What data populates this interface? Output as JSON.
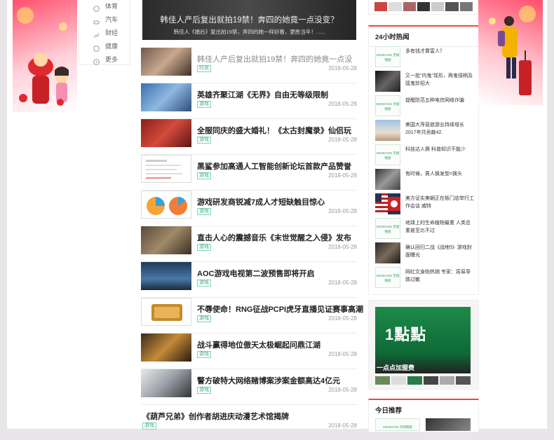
{
  "left_nav": [
    {
      "label": "体育",
      "icon": "sports-icon"
    },
    {
      "label": "汽车",
      "icon": "car-icon"
    },
    {
      "label": "财经",
      "icon": "finance-icon"
    },
    {
      "label": "健康",
      "icon": "health-icon"
    },
    {
      "label": "更多",
      "icon": "more-icon"
    }
  ],
  "hero": {
    "title": "韩佳人产后复出就拍19禁！奔四的她竟一点没变？",
    "subtitle": "韩佳人《婚后》复出拍19禁，奔四的她一样好看，更胜当年！......"
  },
  "news": [
    {
      "title": "韩佳人产后复出就拍19禁！奔四的她竟一点没",
      "tag": "时尚",
      "date": "2018-05-28"
    },
    {
      "title": "英雄齐聚江湖《无界》自由无等级限制",
      "tag": "游戏",
      "date": "2018-05-28"
    },
    {
      "title": "全服同庆的盛大婚礼！《太古封魔录》仙侣玩",
      "tag": "游戏",
      "date": "2018-05-28"
    },
    {
      "title": "黑鲨参加高通人工智能创新论坛首款产品赞誉",
      "tag": "游戏",
      "date": "2018-05-28"
    },
    {
      "title": "游戏研发商锐减7成人才短缺触目惊心",
      "tag": "游戏",
      "date": "2018-05-28"
    },
    {
      "title": "直击人心的震撼音乐《末世觉醒之入侵》发布",
      "tag": "游戏",
      "date": "2018-05-28"
    },
    {
      "title": "AOC游戏电视第二波预售即将开启",
      "tag": "游戏",
      "date": "2018-05-28"
    },
    {
      "title": "不辱使命！RNG征战PCPI虎牙直播见证赛事高潮",
      "tag": "游戏",
      "date": "2018-05-28"
    },
    {
      "title": "战斗赢得地位傲天太极崛起问鼎江湖",
      "tag": "游戏",
      "date": "2018-05-28"
    },
    {
      "title": "警方破特大网络赌博案涉案金额高达4亿元",
      "tag": "游戏",
      "date": "2018-05-28"
    },
    {
      "title": "《葫芦兄弟》创作者胡进庆动漫艺术馆揭牌",
      "tag": "游戏",
      "date": "2018-05-28"
    }
  ],
  "hot24": {
    "title": "24小时热闻",
    "items": [
      {
        "text": "多有钱才算富人？",
        "placeholder": true
      },
      {
        "text": "又一批\"内鬼\"现形，两鬼侵柄及弧鬼妙招大",
        "placeholder": false
      },
      {
        "text": "提醒防范五种电信网络诈骗",
        "placeholder": true
      },
      {
        "text": "美国大萍县旅游业持续增长 2017年共贡献42.",
        "placeholder": false
      },
      {
        "text": "科技达人赛 科普知识不能少",
        "placeholder": true
      },
      {
        "text": "有时候，男人换发型=换头",
        "placeholder": false
      },
      {
        "text": "美方证实美朝正在板门店举行工作会谈 威特",
        "placeholder": false
      },
      {
        "text": "地球上的生命植物最重 人类总重甚至比不过",
        "placeholder": true
      },
      {
        "text": "确认回归二战《战地5》游戏封面曝光",
        "placeholder": false
      },
      {
        "text": "网红文身陷热销 专家：容易导致过敏",
        "placeholder": true
      }
    ],
    "placeholder_label": "DEDECMS 无缩略图"
  },
  "ad": {
    "caption": "一点点加盟费",
    "sign": "1點點"
  },
  "recommend": {
    "title": "今日推荐"
  },
  "colors": {
    "accent": "#e74c3c",
    "tag_green": "#33b27a",
    "banner_red": "#ff4f6c"
  }
}
